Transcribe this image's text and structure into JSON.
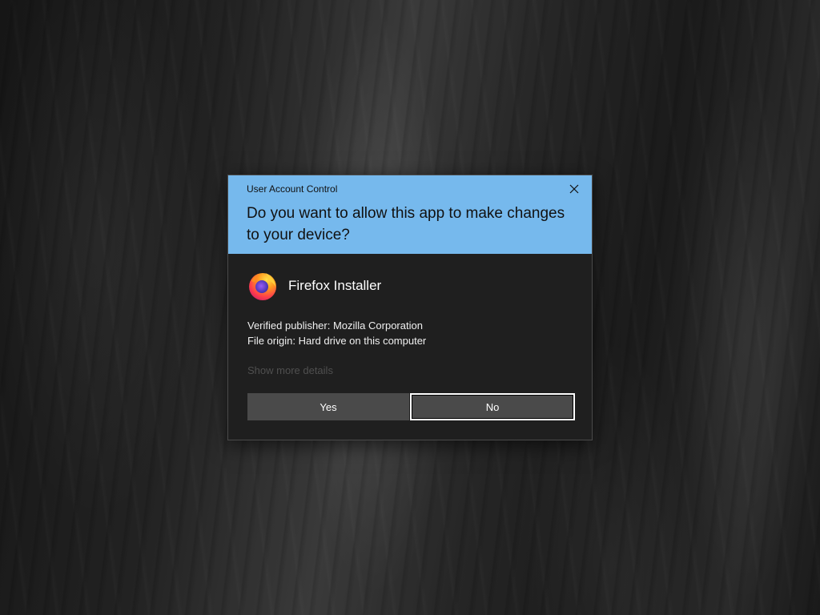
{
  "dialog": {
    "title": "User Account Control",
    "question": "Do you want to allow this app to make changes to your device?",
    "close_icon": "close-icon",
    "accent_color": "#76b9ed"
  },
  "app": {
    "name": "Firefox Installer",
    "icon": "firefox-icon"
  },
  "details": {
    "publisher": "Verified publisher: Mozilla Corporation",
    "origin": "File origin: Hard drive on this computer"
  },
  "more_details_label": "Show more details",
  "buttons": {
    "yes_label": "Yes",
    "no_label": "No"
  }
}
